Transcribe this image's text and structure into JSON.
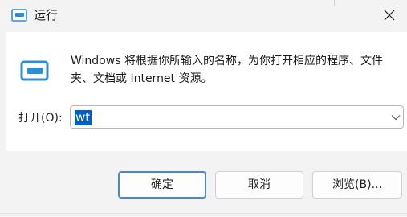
{
  "window": {
    "title": "运行",
    "close_icon": "close-icon",
    "app_icon": "run-icon"
  },
  "content": {
    "description": "Windows 将根据你所输入的名称，为你打开相应的程序、文件夹、文档或 Internet 资源。",
    "open_label": "打开(O):",
    "open_value": "wt",
    "dropdown_icon": "chevron-down-icon"
  },
  "buttons": {
    "ok": "确定",
    "cancel": "取消",
    "browse": "浏览(B)..."
  },
  "colors": {
    "accent": "#0060c0",
    "window_bg": "#f3f3f3",
    "content_bg": "#ffffff",
    "icon_blue": "#2b8fd6"
  }
}
